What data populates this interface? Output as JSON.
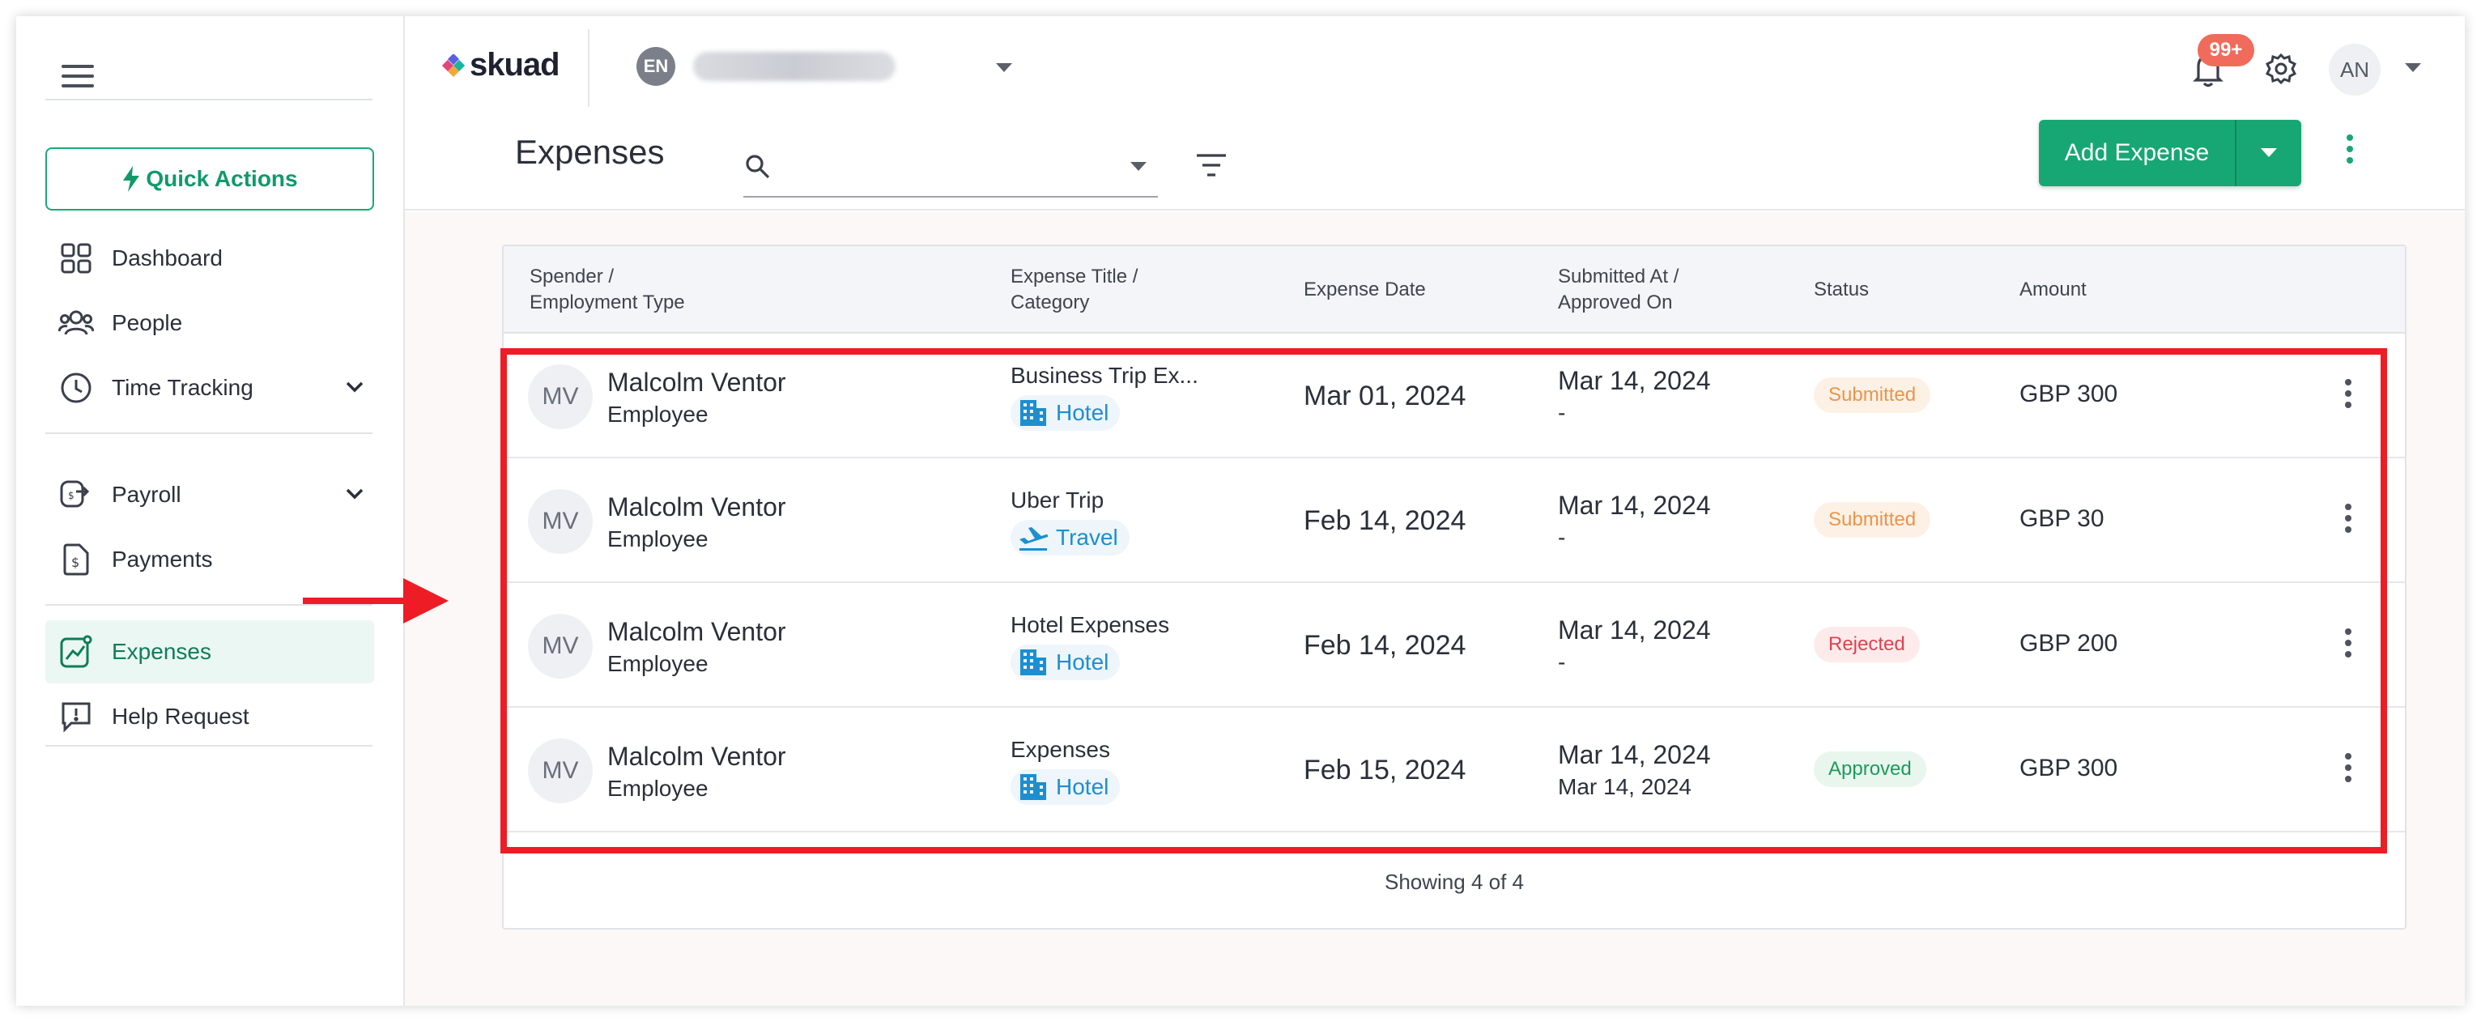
{
  "sidebar": {
    "quick_actions": "Quick Actions",
    "items": [
      {
        "label": "Dashboard",
        "icon": "dashboard-icon"
      },
      {
        "label": "People",
        "icon": "people-icon"
      },
      {
        "label": "Time Tracking",
        "icon": "clock-icon"
      },
      {
        "label": "Payroll",
        "icon": "payroll-icon"
      },
      {
        "label": "Payments",
        "icon": "payments-icon"
      },
      {
        "label": "Expenses",
        "icon": "expenses-icon",
        "active": true
      },
      {
        "label": "Help Request",
        "icon": "help-request-icon"
      }
    ]
  },
  "header": {
    "logo": "skuad",
    "lang_badge": "EN",
    "notification_count": "99+",
    "user_initials": "AN",
    "page_title": "Expenses",
    "search_placeholder": "",
    "add_expense_label": "Add Expense"
  },
  "table": {
    "headers": {
      "spender_line1": "Spender /",
      "spender_line2": "Employment Type",
      "title_line1": "Expense Title /",
      "title_line2": "Category",
      "date": "Expense Date",
      "submitted_line1": "Submitted At /",
      "submitted_line2": "Approved On",
      "status": "Status",
      "amount": "Amount"
    },
    "rows": [
      {
        "initials": "MV",
        "name": "Malcolm Ventor",
        "employment": "Employee",
        "title": "Business Trip Ex...",
        "category": "Hotel",
        "category_icon": "hotel-icon",
        "date": "Mar 01, 2024",
        "submitted": "Mar 14, 2024",
        "approved": "-",
        "status": "Submitted",
        "amount": "GBP 300"
      },
      {
        "initials": "MV",
        "name": "Malcolm Ventor",
        "employment": "Employee",
        "title": "Uber Trip",
        "category": "Travel",
        "category_icon": "plane-icon",
        "date": "Feb 14, 2024",
        "submitted": "Mar 14, 2024",
        "approved": "-",
        "status": "Submitted",
        "amount": "GBP 30"
      },
      {
        "initials": "MV",
        "name": "Malcolm Ventor",
        "employment": "Employee",
        "title": "Hotel Expenses",
        "category": "Hotel",
        "category_icon": "hotel-icon",
        "date": "Feb 14, 2024",
        "submitted": "Mar 14, 2024",
        "approved": "-",
        "status": "Rejected",
        "amount": "GBP 200"
      },
      {
        "initials": "MV",
        "name": "Malcolm Ventor",
        "employment": "Employee",
        "title": "Expenses",
        "category": "Hotel",
        "category_icon": "hotel-icon",
        "date": "Feb 15, 2024",
        "submitted": "Mar 14, 2024",
        "approved": "Mar 14, 2024",
        "status": "Approved",
        "amount": "GBP 300"
      }
    ],
    "footer": "Showing 4 of 4"
  },
  "colors": {
    "brand_green": "#17a774",
    "submitted": "#e9954a",
    "rejected": "#e0414f",
    "approved": "#1e9a5a",
    "highlight": "#ee1c24"
  }
}
